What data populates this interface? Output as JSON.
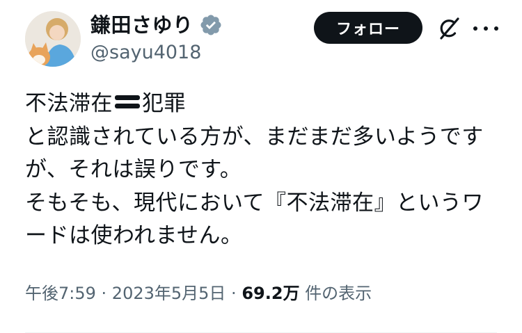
{
  "author": {
    "display_name": "鎌田さゆり",
    "handle": "@sayu4018",
    "verified": true,
    "avatar_icon": "profile-photo-with-cat"
  },
  "actions": {
    "follow_label": "フォロー",
    "grok_icon": "grok-icon",
    "more_icon": "more-icon"
  },
  "tweet": {
    "line1_part1": "不法滞在",
    "line1_emoji": "heavy-equals-sign-emoji",
    "line1_part2": "犯罪",
    "line2": "と認識されている方が、まだまだ多いようです",
    "line3": "が、それは誤りです。",
    "line4": "そもそも、現代において『不法滞在』というワ",
    "line5": "ードは使われません。"
  },
  "meta": {
    "time": "午後7:59",
    "separator": " · ",
    "date": "2023年5月5日",
    "views_count": "69.2万",
    "views_label": " 件の表示"
  },
  "colors": {
    "text_primary": "#0f1419",
    "text_secondary": "#536471",
    "verified_badge": "#829aab",
    "follow_button_bg": "#0f1419"
  }
}
